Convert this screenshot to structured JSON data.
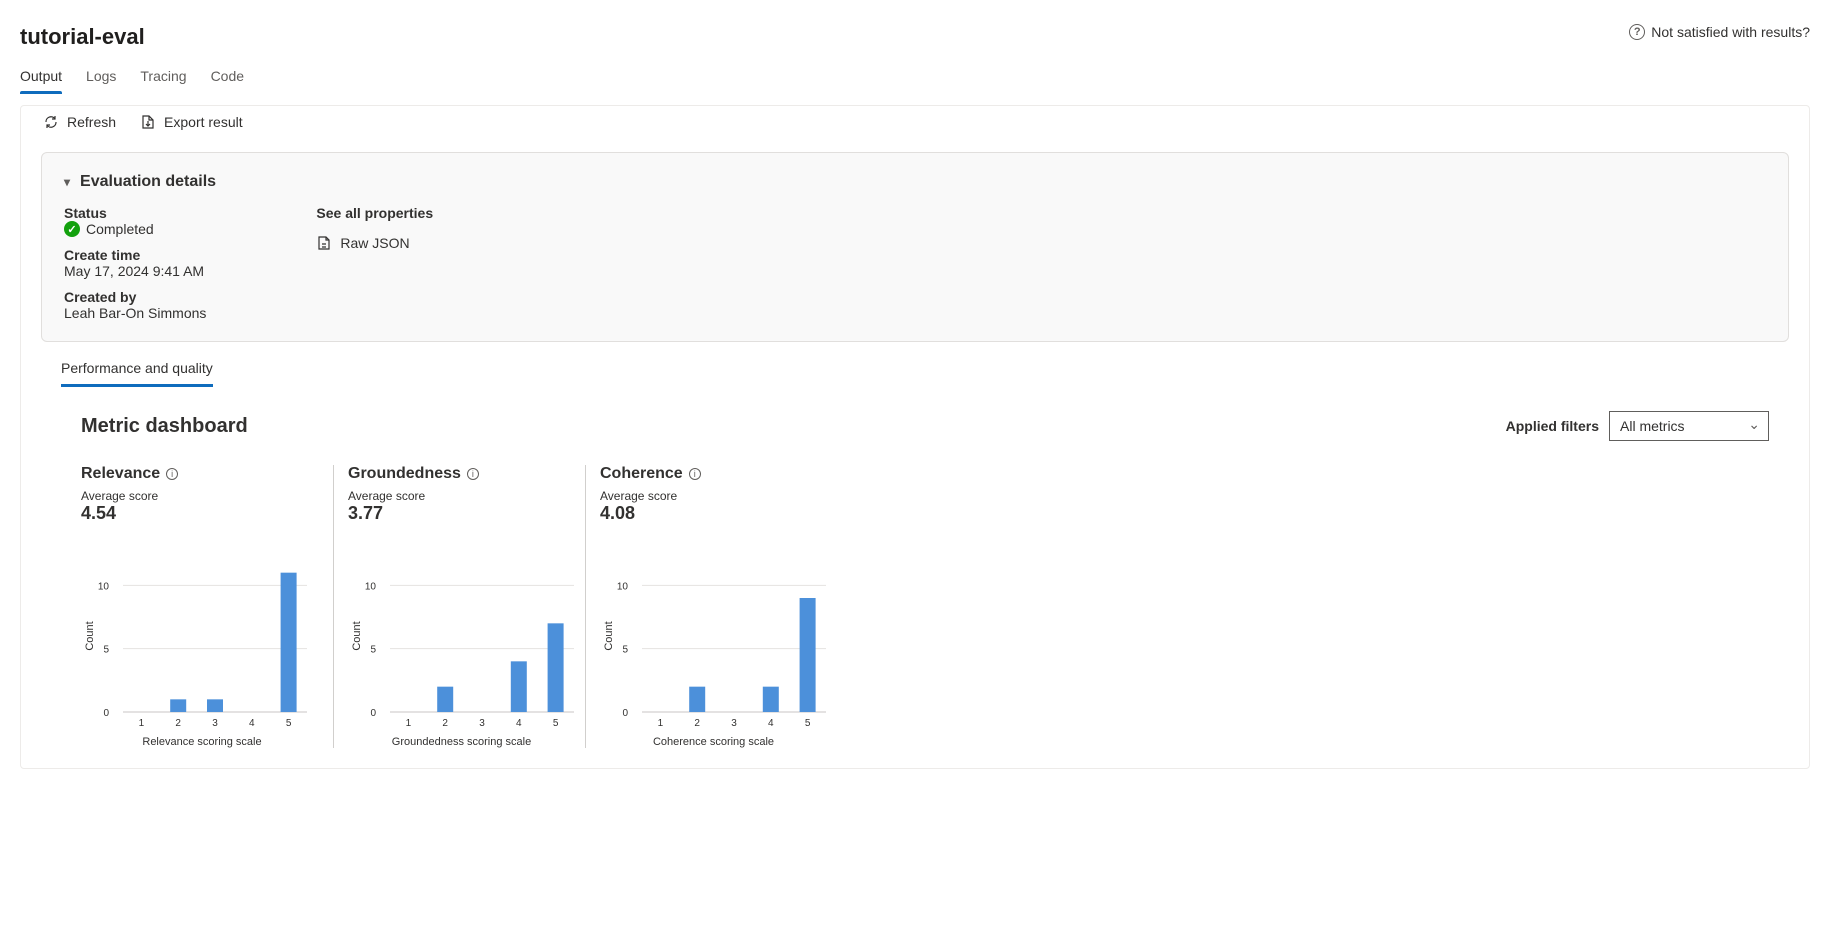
{
  "header": {
    "title": "tutorial-eval",
    "feedback": "Not satisfied with results?"
  },
  "tabs": {
    "items": [
      "Output",
      "Logs",
      "Tracing",
      "Code"
    ],
    "activeIndex": 0
  },
  "toolbar": {
    "refresh": "Refresh",
    "export": "Export result"
  },
  "details": {
    "heading": "Evaluation details",
    "status_label": "Status",
    "status_value": "Completed",
    "create_label": "Create time",
    "create_value": "May 17, 2024 9:41 AM",
    "createdby_label": "Created by",
    "createdby_value": "Leah Bar-On Simmons",
    "props_label": "See all properties",
    "raw_json": "Raw JSON"
  },
  "subtabs": {
    "label": "Performance and quality"
  },
  "dashboard": {
    "title": "Metric dashboard",
    "filters_label": "Applied filters",
    "filters_value": "All metrics",
    "avg_label": "Average score"
  },
  "metrics": [
    {
      "name": "Relevance",
      "avg": "4.54",
      "xlabel": "Relevance scoring scale"
    },
    {
      "name": "Groundedness",
      "avg": "3.77",
      "xlabel": "Groundedness scoring scale"
    },
    {
      "name": "Coherence",
      "avg": "4.08",
      "xlabel": "Coherence scoring scale"
    }
  ],
  "chart_data": [
    {
      "type": "bar",
      "title": "Relevance",
      "xlabel": "Relevance scoring scale",
      "ylabel": "Count",
      "ylim": [
        0,
        12
      ],
      "yticks": [
        5,
        10
      ],
      "categories": [
        "1",
        "2",
        "3",
        "4",
        "5"
      ],
      "values": [
        0,
        1,
        1,
        0,
        11
      ]
    },
    {
      "type": "bar",
      "title": "Groundedness",
      "xlabel": "Groundedness scoring scale",
      "ylabel": "Count",
      "ylim": [
        0,
        12
      ],
      "yticks": [
        5,
        10
      ],
      "categories": [
        "1",
        "2",
        "3",
        "4",
        "5"
      ],
      "values": [
        0,
        2,
        0,
        4,
        7
      ]
    },
    {
      "type": "bar",
      "title": "Coherence",
      "xlabel": "Coherence scoring scale",
      "ylabel": "Count",
      "ylim": [
        0,
        12
      ],
      "yticks": [
        5,
        10
      ],
      "categories": [
        "1",
        "2",
        "3",
        "4",
        "5"
      ],
      "values": [
        0,
        2,
        0,
        2,
        9
      ]
    }
  ]
}
